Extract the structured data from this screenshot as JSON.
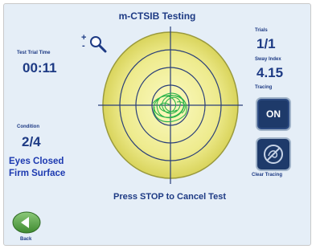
{
  "header": {
    "title": "m-CTSIB Testing"
  },
  "timer": {
    "label": "Test Trial Time",
    "value": "00:11"
  },
  "condition": {
    "label": "Condition",
    "value": "2/4",
    "line1": "Eyes Closed",
    "line2": "Firm Surface"
  },
  "trials": {
    "label": "Trials",
    "value": "1/1"
  },
  "sway": {
    "label": "Sway Index",
    "value": "4.15"
  },
  "tracing": {
    "label": "Tracing",
    "on_label": "ON",
    "clear_label": "Clear Tracing"
  },
  "zoom": {
    "plus": "+",
    "minus": "-"
  },
  "message": "Press STOP to Cancel Test",
  "back": {
    "label": "Back"
  },
  "colors": {
    "accent": "#1d3a84",
    "target": "#e8e37a",
    "trace": "#2bb34a",
    "button": "#1e3a6a",
    "back": "#4f9a3f"
  }
}
